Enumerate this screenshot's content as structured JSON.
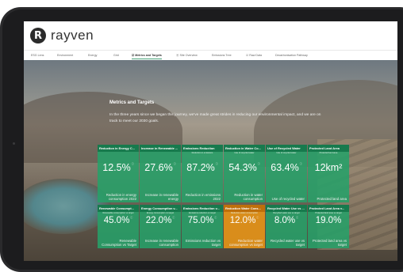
{
  "app": {
    "brand": "rayven",
    "logo_letter": "R"
  },
  "tabs": [
    {
      "label": "ESG Lens",
      "active": false
    },
    {
      "label": "Environment",
      "active": false
    },
    {
      "label": "Energy",
      "active": false
    },
    {
      "label": "Grid",
      "active": false
    },
    {
      "label": "☑ Metrics and Targets",
      "active": true
    },
    {
      "label": "⦿ Site Overview",
      "active": false
    },
    {
      "label": "Emissions Tree",
      "active": false
    },
    {
      "label": "☑ Raw Data",
      "active": false
    },
    {
      "label": "Decarbonisation Pathway",
      "active": false
    }
  ],
  "main": {
    "heading": "Metrics and Targets",
    "intro": "In the three years since we began this journey, we've made great strides in reducing our environmental impact, and we are on track to meet our 2030 goals."
  },
  "tiles_top": [
    {
      "title": "Reduction in Energy C...",
      "subtitle": "",
      "value": "12.5%",
      "desc": "Reduction in energy consumption 2022",
      "info": true,
      "color": "green"
    },
    {
      "title": "Increase in Renewable ...",
      "subtitle": "",
      "value": "27.6%",
      "desc": "Increase in renewable energy",
      "info": true,
      "color": "green"
    },
    {
      "title": "Emissions Reduction",
      "subtitle": "Reduction in emissions",
      "value": "87.2%",
      "desc": "Reduction in emissions 2022",
      "info": true,
      "color": "green"
    },
    {
      "title": "Reduction in Water Co...",
      "subtitle": "Use of recycled water",
      "value": "54.3%",
      "desc": "Reduction in water consumption",
      "info": true,
      "color": "green"
    },
    {
      "title": "Use of Recycled Water",
      "subtitle": "Use of recycled water",
      "value": "63.4%",
      "desc": "Use of recycled water",
      "info": true,
      "color": "green"
    },
    {
      "title": "Protected Land Area",
      "subtitle": "Protected land area",
      "value": "12km²",
      "desc": "Protected land area",
      "info": false,
      "color": "green"
    }
  ],
  "tiles_bottom": [
    {
      "title": "Renewable Consumpt...",
      "subtitle": "Renewable consumption vs target",
      "value": "45.0%",
      "desc": "Renewable Consumption vs Target",
      "info": true,
      "color": "green"
    },
    {
      "title": "Energy Consumption v...",
      "subtitle": "Energy consumption vs target",
      "value": "22.0%",
      "desc": "Increase in renewable consumption",
      "info": true,
      "color": "green"
    },
    {
      "title": "Emissions Reduction v...",
      "subtitle": "Emissions reduction vs target",
      "value": "75.0%",
      "desc": "Emissions reduction vs target",
      "info": true,
      "color": "green"
    },
    {
      "title": "Reduction Water Cons...",
      "subtitle": "Reduction water consumption",
      "value": "12.0%",
      "desc": "Reduction water consumption vs target",
      "info": true,
      "color": "orange"
    },
    {
      "title": "Recycled Water Use vs ...",
      "subtitle": "Recycled water use vs target",
      "value": "8.0%",
      "desc": "Recycled water use vs target",
      "info": true,
      "color": "green"
    },
    {
      "title": "Protected Land Area v...",
      "subtitle": "Protected land area vs target",
      "value": "19.0%",
      "desc": "Protected land area vs target",
      "info": false,
      "color": "green"
    }
  ],
  "colors": {
    "tile_green": "#27a069",
    "tile_orange": "#e49218",
    "tab_accent": "#4aa37a"
  }
}
